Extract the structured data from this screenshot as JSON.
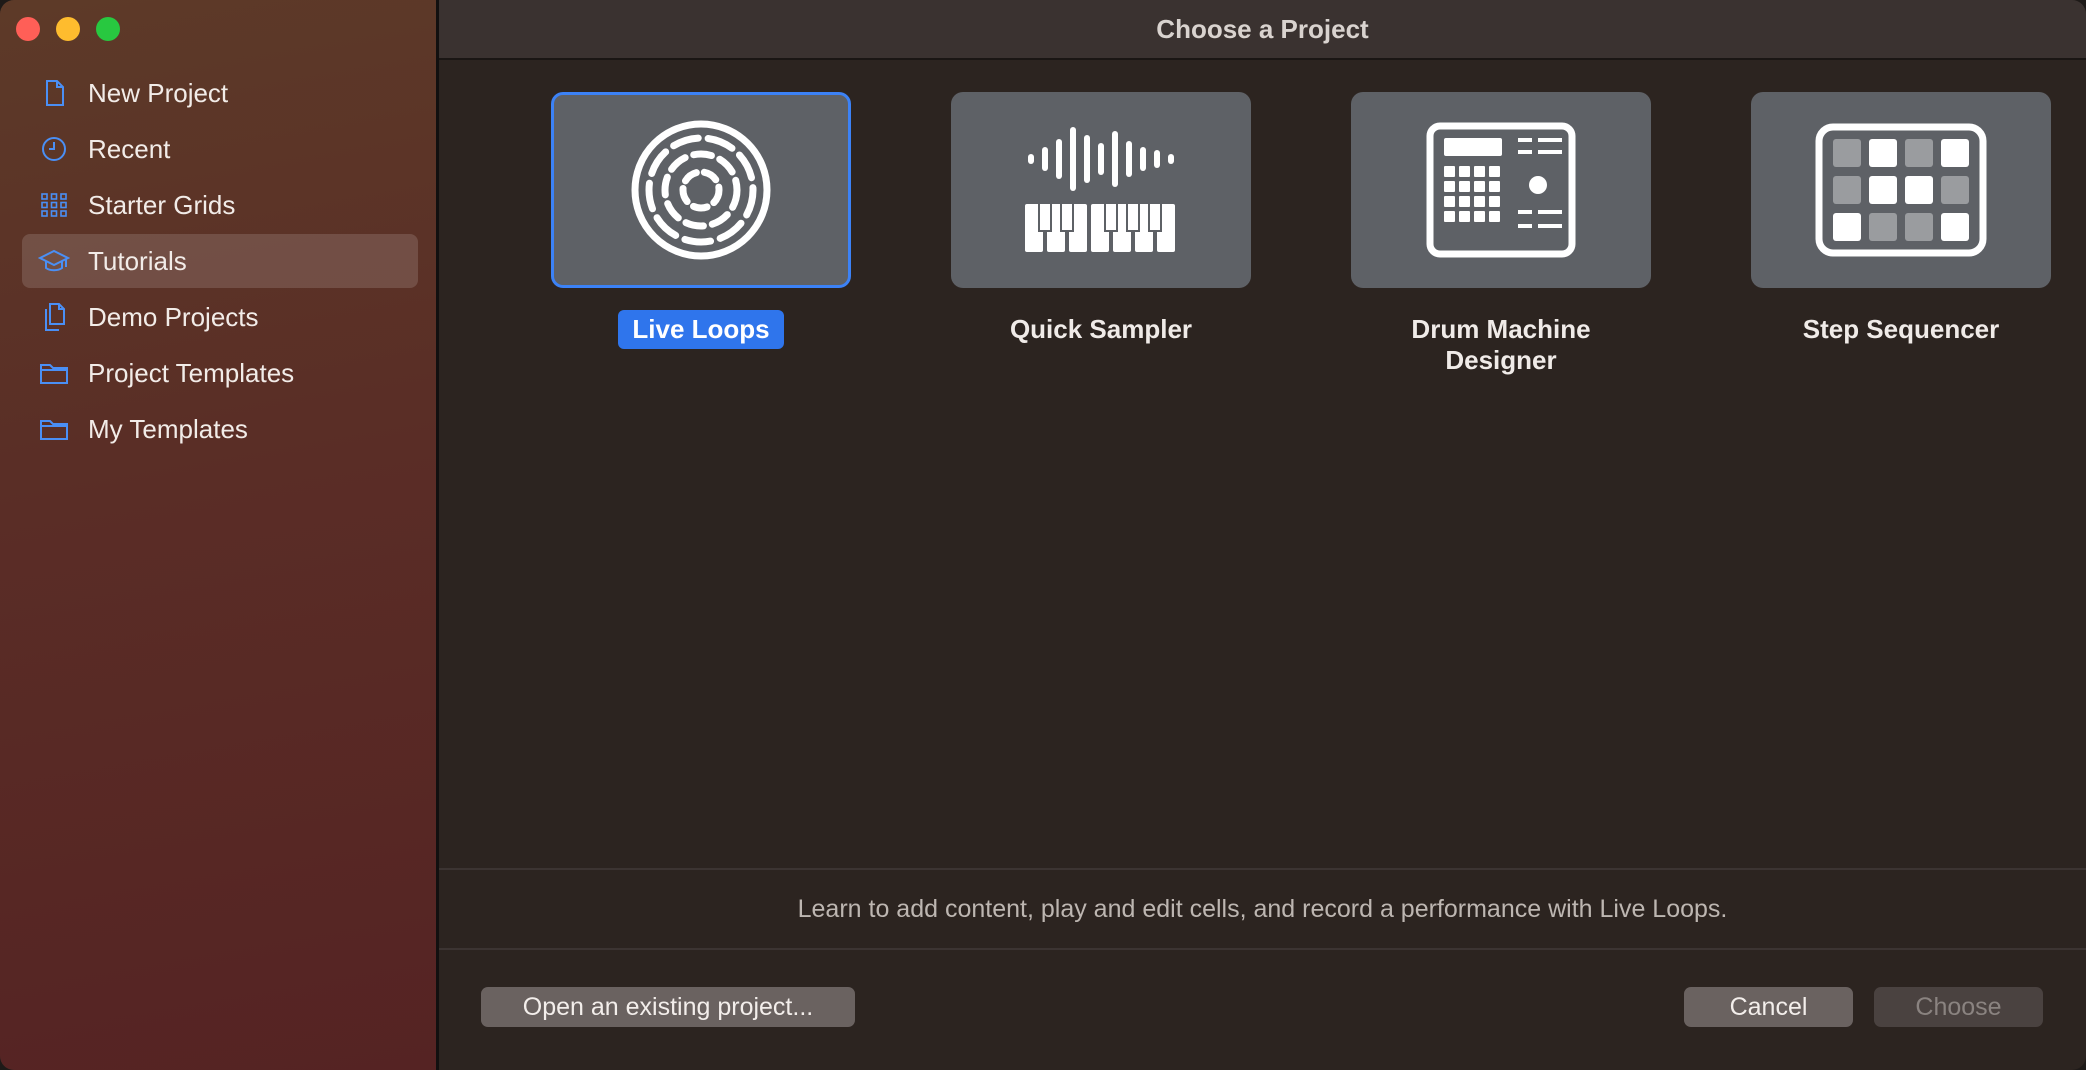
{
  "window": {
    "title": "Choose a Project"
  },
  "sidebar": {
    "items": [
      {
        "label": "New Project",
        "icon": "doc-icon"
      },
      {
        "label": "Recent",
        "icon": "clock-icon"
      },
      {
        "label": "Starter Grids",
        "icon": "grid-dots-icon"
      },
      {
        "label": "Tutorials",
        "icon": "graduation-cap-icon",
        "selected": true
      },
      {
        "label": "Demo Projects",
        "icon": "doc-stack-icon"
      },
      {
        "label": "Project Templates",
        "icon": "folder-icon"
      },
      {
        "label": "My Templates",
        "icon": "folder-icon"
      }
    ]
  },
  "templates": [
    {
      "label": "Live Loops",
      "icon": "live-loops-icon",
      "selected": true
    },
    {
      "label": "Quick Sampler",
      "icon": "waveform-keyboard-icon"
    },
    {
      "label": "Drum Machine Designer",
      "icon": "drum-machine-icon"
    },
    {
      "label": "Step Sequencer",
      "icon": "step-sequencer-icon"
    }
  ],
  "description": "Learn to add content, play and edit cells, and record a performance with Live Loops.",
  "buttons": {
    "open_existing": "Open an existing project...",
    "cancel": "Cancel",
    "choose": "Choose"
  },
  "colors": {
    "accent": "#2f75ec",
    "sidebar_icon": "#4a8ff5",
    "close": "#ff5f57",
    "minimize": "#febc2e",
    "maximize": "#28c840"
  }
}
